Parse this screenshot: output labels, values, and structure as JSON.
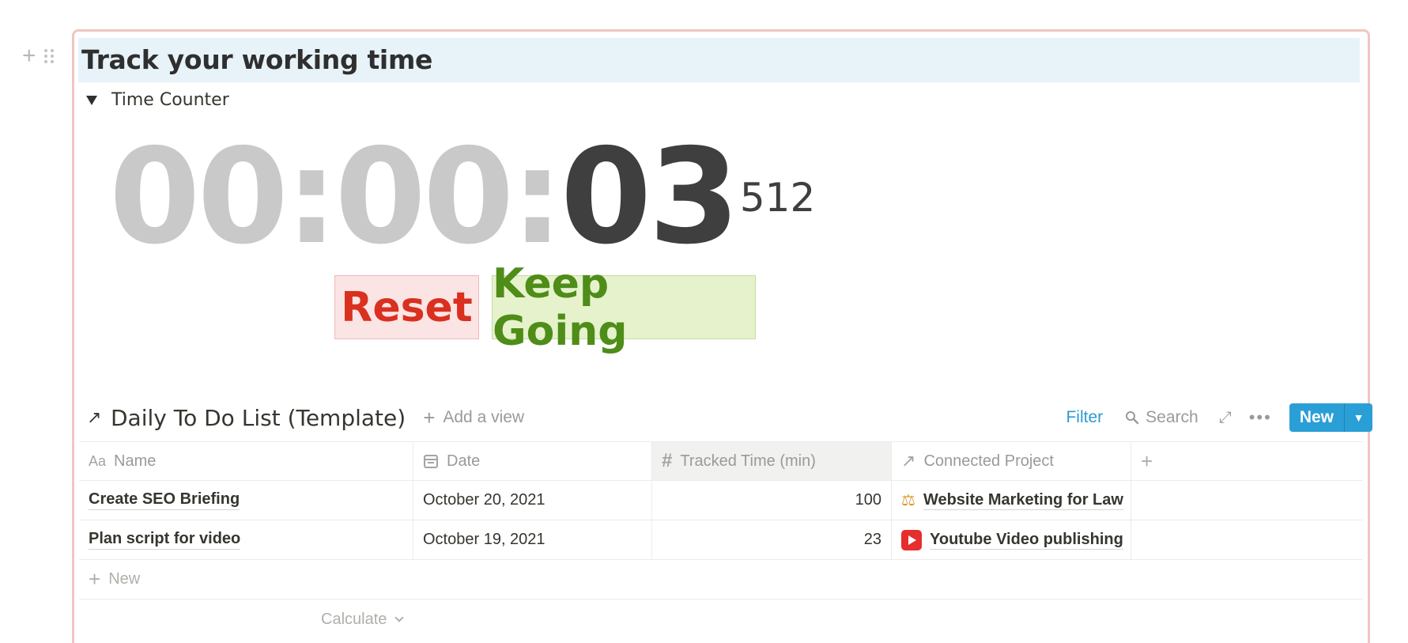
{
  "page": {
    "title": "Track your working time"
  },
  "toggle": {
    "label": "Time Counter"
  },
  "timer": {
    "hours": "00",
    "minutes": "00",
    "seconds": "03",
    "milliseconds": "512"
  },
  "buttons": {
    "reset": "Reset",
    "keep_going": "Keep Going"
  },
  "database": {
    "title": "Daily To Do List (Template)",
    "add_view": "Add a view",
    "filter": "Filter",
    "search": "Search",
    "new": "New",
    "columns": [
      "Name",
      "Date",
      "Tracked Time (min)",
      "Connected Project"
    ],
    "rows": [
      {
        "name": "Create SEO Briefing",
        "date": "October 20, 2021",
        "tracked": "100",
        "project": "Website Marketing for Law",
        "project_icon": "scale-icon"
      },
      {
        "name": "Plan script for video",
        "date": "October 19, 2021",
        "tracked": "23",
        "project": "Youtube Video publishing",
        "project_icon": "youtube-icon"
      }
    ],
    "new_row": "New",
    "calculate": "Calculate"
  },
  "colors": {
    "accent": "#2a9fd6",
    "reset_text": "#d9301f",
    "keep_going_text": "#4e8d18",
    "title_bg": "#e7f3f8"
  }
}
